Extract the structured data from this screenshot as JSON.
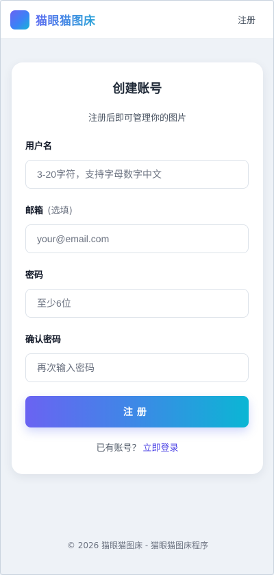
{
  "header": {
    "brand_name": "猫眼猫图床",
    "nav_register": "注册",
    "logo_icon": "logo-gradient-square"
  },
  "colors": {
    "accent_start": "#6a63f2",
    "accent_end": "#0bb6d4",
    "link": "#4f46e5",
    "background": "#eef2f7"
  },
  "form": {
    "title": "创建账号",
    "subtitle": "注册后即可管理你的图片",
    "username": {
      "label": "用户名",
      "value": "",
      "placeholder": "3-20字符，支持字母数字中文"
    },
    "email": {
      "label": "邮箱",
      "optional": "(选填)",
      "value": "",
      "placeholder": "your@email.com"
    },
    "password": {
      "label": "密码",
      "value": "",
      "placeholder": "至少6位"
    },
    "confirm": {
      "label": "确认密码",
      "value": "",
      "placeholder": "再次输入密码"
    },
    "submit_label": "注册",
    "login_prompt": "已有账号？",
    "login_link": "立即登录"
  },
  "footer": {
    "copyright": "© 2026 猫眼猫图床 - 猫眼猫图床程序"
  }
}
